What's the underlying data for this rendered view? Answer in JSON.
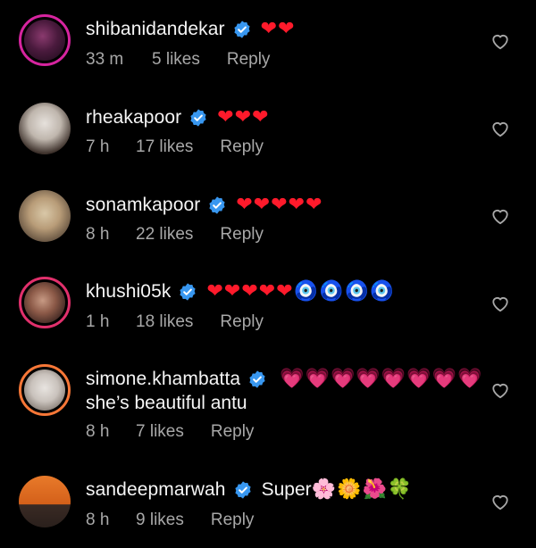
{
  "comments": [
    {
      "username": "shibanidandekar",
      "text": "",
      "emojis": [
        "❤",
        "❤"
      ],
      "body": "",
      "time": "33 m",
      "likes": "5 likes",
      "reply": "Reply"
    },
    {
      "username": "rheakapoor",
      "text": "",
      "emojis": [
        "❤",
        "❤",
        "❤"
      ],
      "body": "",
      "time": "7 h",
      "likes": "17 likes",
      "reply": "Reply"
    },
    {
      "username": "sonamkapoor",
      "text": "",
      "emojis": [
        "❤",
        "❤",
        "❤",
        "❤",
        "❤"
      ],
      "body": "",
      "time": "8 h",
      "likes": "22 likes",
      "reply": "Reply"
    },
    {
      "username": "khushi05k",
      "text": "",
      "emojis": [
        "❤",
        "❤",
        "❤",
        "❤",
        "❤",
        "🧿",
        "🧿",
        "🧿",
        "🧿"
      ],
      "body": "",
      "time": "1 h",
      "likes": "18 likes",
      "reply": "Reply"
    },
    {
      "username": "simone.khambatta",
      "text": "",
      "emojis": [
        "💗",
        "💗",
        "💗",
        "💗",
        "💗",
        "💗",
        "💗",
        "💗"
      ],
      "body": "she’s beautiful antu",
      "time": "8 h",
      "likes": "7 likes",
      "reply": "Reply"
    },
    {
      "username": "sandeepmarwah",
      "text": "Super",
      "emojis": [
        "🌸",
        "🌼",
        "🌺",
        "🍀"
      ],
      "body": "",
      "time": "8 h",
      "likes": "9 likes",
      "reply": "Reply"
    }
  ],
  "colors": {
    "background": "#000000",
    "primary_text": "#f5f5f5",
    "secondary_text": "#a8a8a8",
    "verified_blue": "#3897f0",
    "heart_red": "#ff1a2b"
  },
  "icons": {
    "verified": "verified-badge-icon",
    "like": "heart-outline-icon"
  }
}
